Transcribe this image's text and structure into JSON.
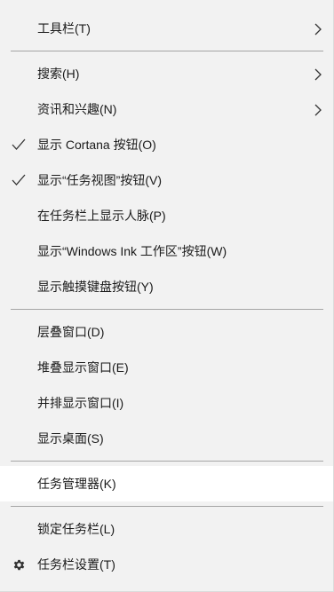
{
  "menu": {
    "toolbars": "工具栏(T)",
    "search": "搜索(H)",
    "news": "资讯和兴趣(N)",
    "show_cortana": "显示 Cortana 按钮(O)",
    "show_taskview": "显示“任务视图”按钮(V)",
    "show_people": "在任务栏上显示人脉(P)",
    "show_ink": "显示“Windows Ink 工作区”按钮(W)",
    "show_touch_keyboard": "显示触摸键盘按钮(Y)",
    "cascade": "层叠窗口(D)",
    "stack": "堆叠显示窗口(E)",
    "side_by_side": "并排显示窗口(I)",
    "show_desktop": "显示桌面(S)",
    "task_manager": "任务管理器(K)",
    "lock_taskbar": "锁定任务栏(L)",
    "taskbar_settings": "任务栏设置(T)"
  },
  "icons": {
    "submenu": "chevron-right-icon",
    "checked": "checkmark-icon",
    "settings": "gear-icon"
  },
  "colors": {
    "menu_bg": "#f2f2f2",
    "highlight_bg": "#ffffff",
    "text": "#1a1a1a",
    "separator": "#a5a5a5"
  }
}
